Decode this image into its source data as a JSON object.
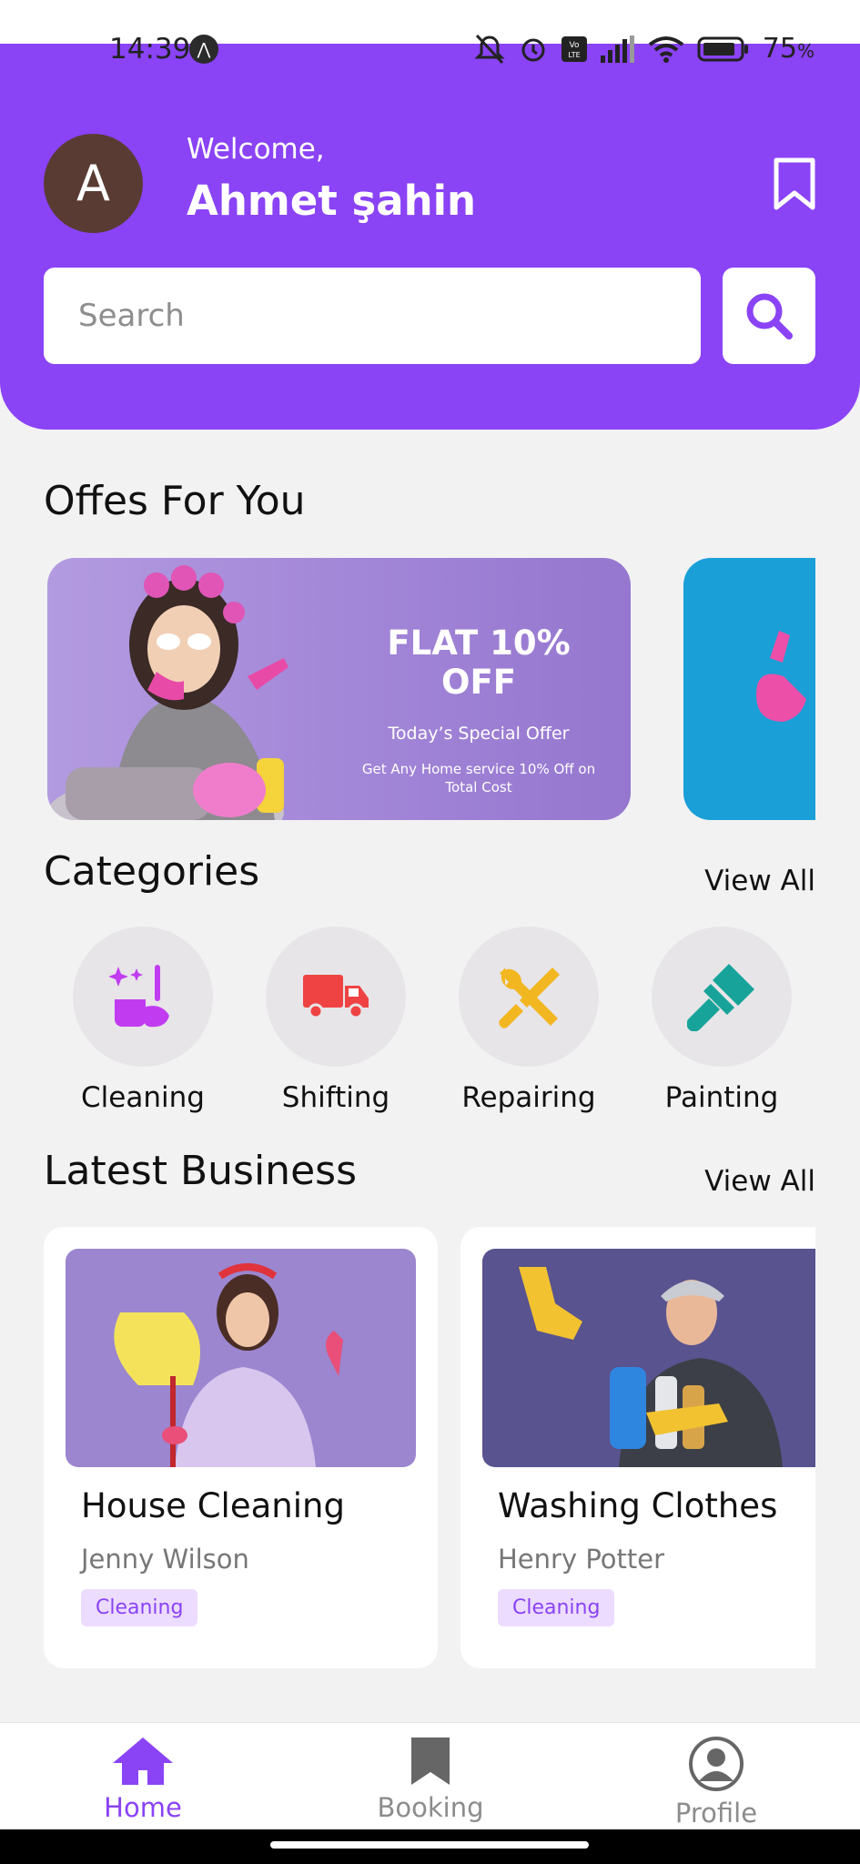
{
  "status": {
    "time": "14:39",
    "battery": "75"
  },
  "header": {
    "avatar_letter": "A",
    "welcome": "Welcome,",
    "user_name": "Ahmet şahin"
  },
  "search": {
    "placeholder": "Search"
  },
  "offers": {
    "title": "Offes For You",
    "cards": [
      {
        "headline": "FLAT 10% OFF",
        "subtitle": "Today’s Special Offer",
        "description": "Get Any Home service 10% Off on Total Cost"
      }
    ]
  },
  "categories": {
    "title": "Categories",
    "view_all": "View All",
    "items": [
      {
        "label": "Cleaning",
        "icon": "cleaning-icon",
        "color": "#c13cf0"
      },
      {
        "label": "Shifting",
        "icon": "truck-icon",
        "color": "#ef4343"
      },
      {
        "label": "Repairing",
        "icon": "tools-icon",
        "color": "#f2b620"
      },
      {
        "label": "Painting",
        "icon": "paint-brush-icon",
        "color": "#17a399"
      }
    ]
  },
  "latest_business": {
    "title": "Latest Business",
    "view_all": "View All",
    "items": [
      {
        "title": "House Cleaning",
        "owner": "Jenny Wilson",
        "tag": "Cleaning"
      },
      {
        "title": "Washing Clothes",
        "owner": "Henry Potter",
        "tag": "Cleaning"
      }
    ]
  },
  "bottom_nav": [
    {
      "label": "Home",
      "active": true
    },
    {
      "label": "Booking",
      "active": false
    },
    {
      "label": "Profile",
      "active": false
    }
  ],
  "colors": {
    "accent": "#8a43f5",
    "tag_bg": "#ecdcff"
  }
}
